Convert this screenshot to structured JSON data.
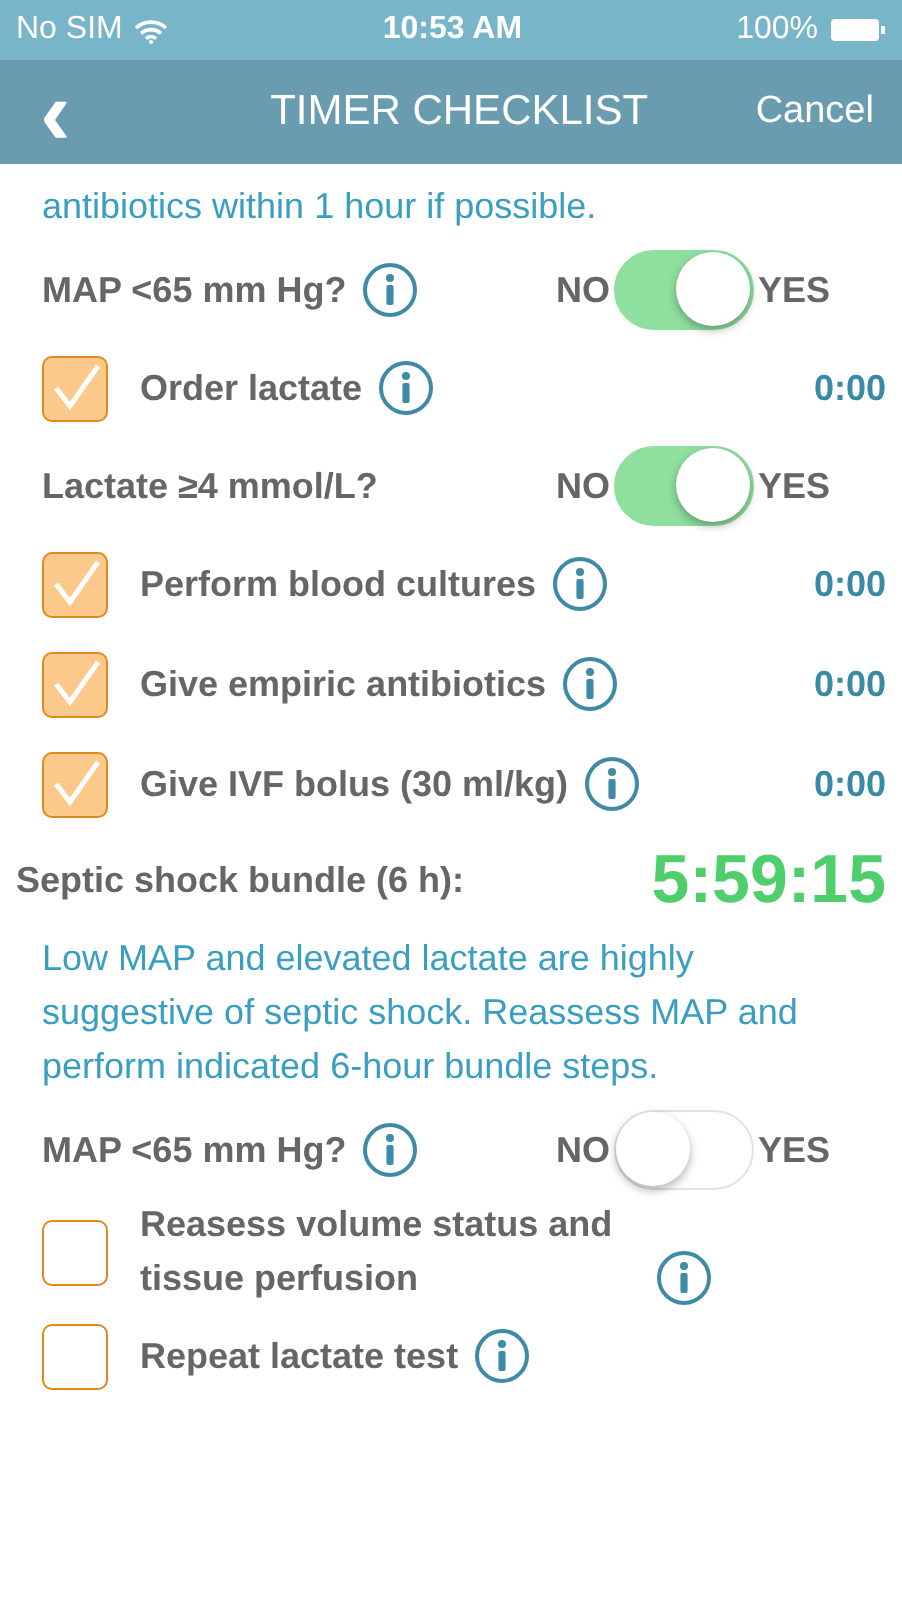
{
  "status_bar": {
    "carrier": "No SIM",
    "time": "10:53 AM",
    "battery": "100%"
  },
  "nav_bar": {
    "back": "‹",
    "title": "TIMER CHECKLIST",
    "action": "Cancel"
  },
  "items": [
    {
      "kind": "note",
      "text": "antibiotics within 1 hour if possible."
    },
    {
      "kind": "toggle",
      "label": "MAP <65 mm Hg?",
      "info": true,
      "off_label": "NO",
      "on_label": "YES",
      "on": true
    },
    {
      "kind": "task",
      "label": "Order lactate",
      "info": true,
      "checked": true,
      "timer": "0:00"
    },
    {
      "kind": "toggle",
      "label": "Lactate ≥4 mmol/L?",
      "info": false,
      "off_label": "NO",
      "on_label": "YES",
      "on": true
    },
    {
      "kind": "task",
      "label": "Perform blood cultures",
      "info": true,
      "checked": true,
      "timer": "0:00"
    },
    {
      "kind": "task",
      "label": "Give empiric antibiotics",
      "info": true,
      "checked": true,
      "timer": "0:00"
    },
    {
      "kind": "task",
      "label": "Give IVF bolus (30 ml/kg)",
      "info": true,
      "checked": true,
      "timer": "0:00"
    },
    {
      "kind": "section",
      "label": "Septic shock bundle (6 h):",
      "timer": "5:59:15"
    },
    {
      "kind": "note",
      "text": "Low MAP and elevated lactate are highly suggestive of septic shock. Reassess MAP and perform indicated 6-hour bundle steps."
    },
    {
      "kind": "toggle",
      "label": "MAP <65 mm Hg?",
      "info": true,
      "off_label": "NO",
      "on_label": "YES",
      "on": false
    },
    {
      "kind": "task",
      "label": "Reasess volume status and tissue perfusion",
      "info": true,
      "checked": false
    },
    {
      "kind": "task",
      "label": "Repeat lactate test",
      "info": true,
      "checked": false
    }
  ]
}
